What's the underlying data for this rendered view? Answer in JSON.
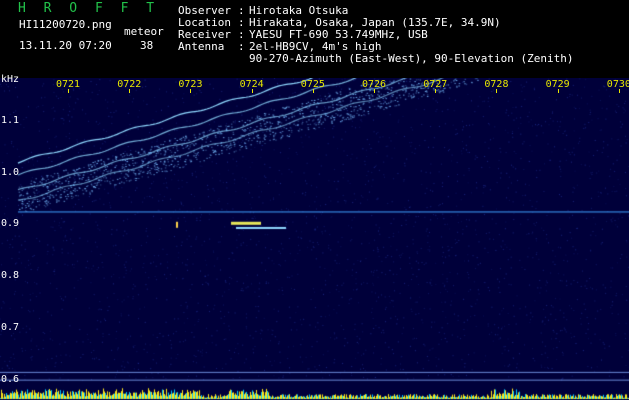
{
  "header": {
    "brand": "H R O F F T",
    "filename": "HI11200720.png",
    "timestamp": "13.11.20 07:20",
    "type_label": "meteor",
    "count": "38",
    "observer_label": "Observer",
    "observer": "Hirotaka Otsuka",
    "location_label": "Location",
    "location": "Hirakata, Osaka, Japan (135.7E, 34.9N)",
    "receiver_label": "Receiver",
    "receiver": "YAESU FT-690 53.749MHz, USB",
    "antenna_label": "Antenna",
    "antenna": "2el-HB9CV, 4m's high",
    "antenna2": "90-270-Azimuth (East-West), 90-Elevation (Zenith)"
  },
  "chart_data": {
    "type": "heatmap",
    "ylabel": "kHz",
    "x_ticks": [
      "0721",
      "0722",
      "0723",
      "0724",
      "0725",
      "0726",
      "0727",
      "0728",
      "0729",
      "0730"
    ],
    "y_ticks": [
      "1.1",
      "1.0",
      "0.9",
      "0.8",
      "0.7",
      "0.6"
    ],
    "ylim": [
      0.58,
      1.15
    ],
    "colors": {
      "background": "#00003a",
      "signal": "#8fd8ff",
      "tick": "#e8e800",
      "hist": "#ffe81a",
      "hist2": "#00c8ff"
    }
  }
}
